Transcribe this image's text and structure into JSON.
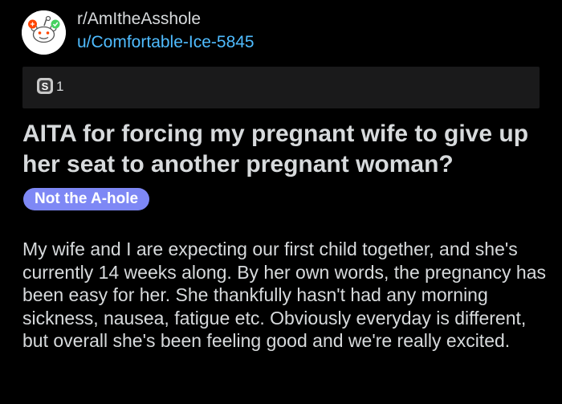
{
  "header": {
    "subreddit": "r/AmItheAsshole",
    "username": "u/Comfortable-Ice-5845"
  },
  "awards": {
    "icon": "silver-award-icon",
    "count": "1"
  },
  "post": {
    "title": "AITA for forcing my pregnant wife to give up her seat to another pregnant woman?",
    "flair": "Not the A-hole",
    "body": "My wife and I are expecting our first child together, and she's currently 14 weeks along. By her own words, the pregnancy has been easy for her. She thankfully hasn't had any morning sickness, nausea, fatigue etc. Obviously everyday is different, but overall she's been feeling good and we're really excited."
  },
  "colors": {
    "background": "#000000",
    "text": "#d7dadc",
    "username": "#4fbcff",
    "award_bar": "#1a1a1b",
    "flair_bg": "#7e88f5",
    "subreddit_icon_red": "#ff4500",
    "badge_green": "#46d160"
  }
}
